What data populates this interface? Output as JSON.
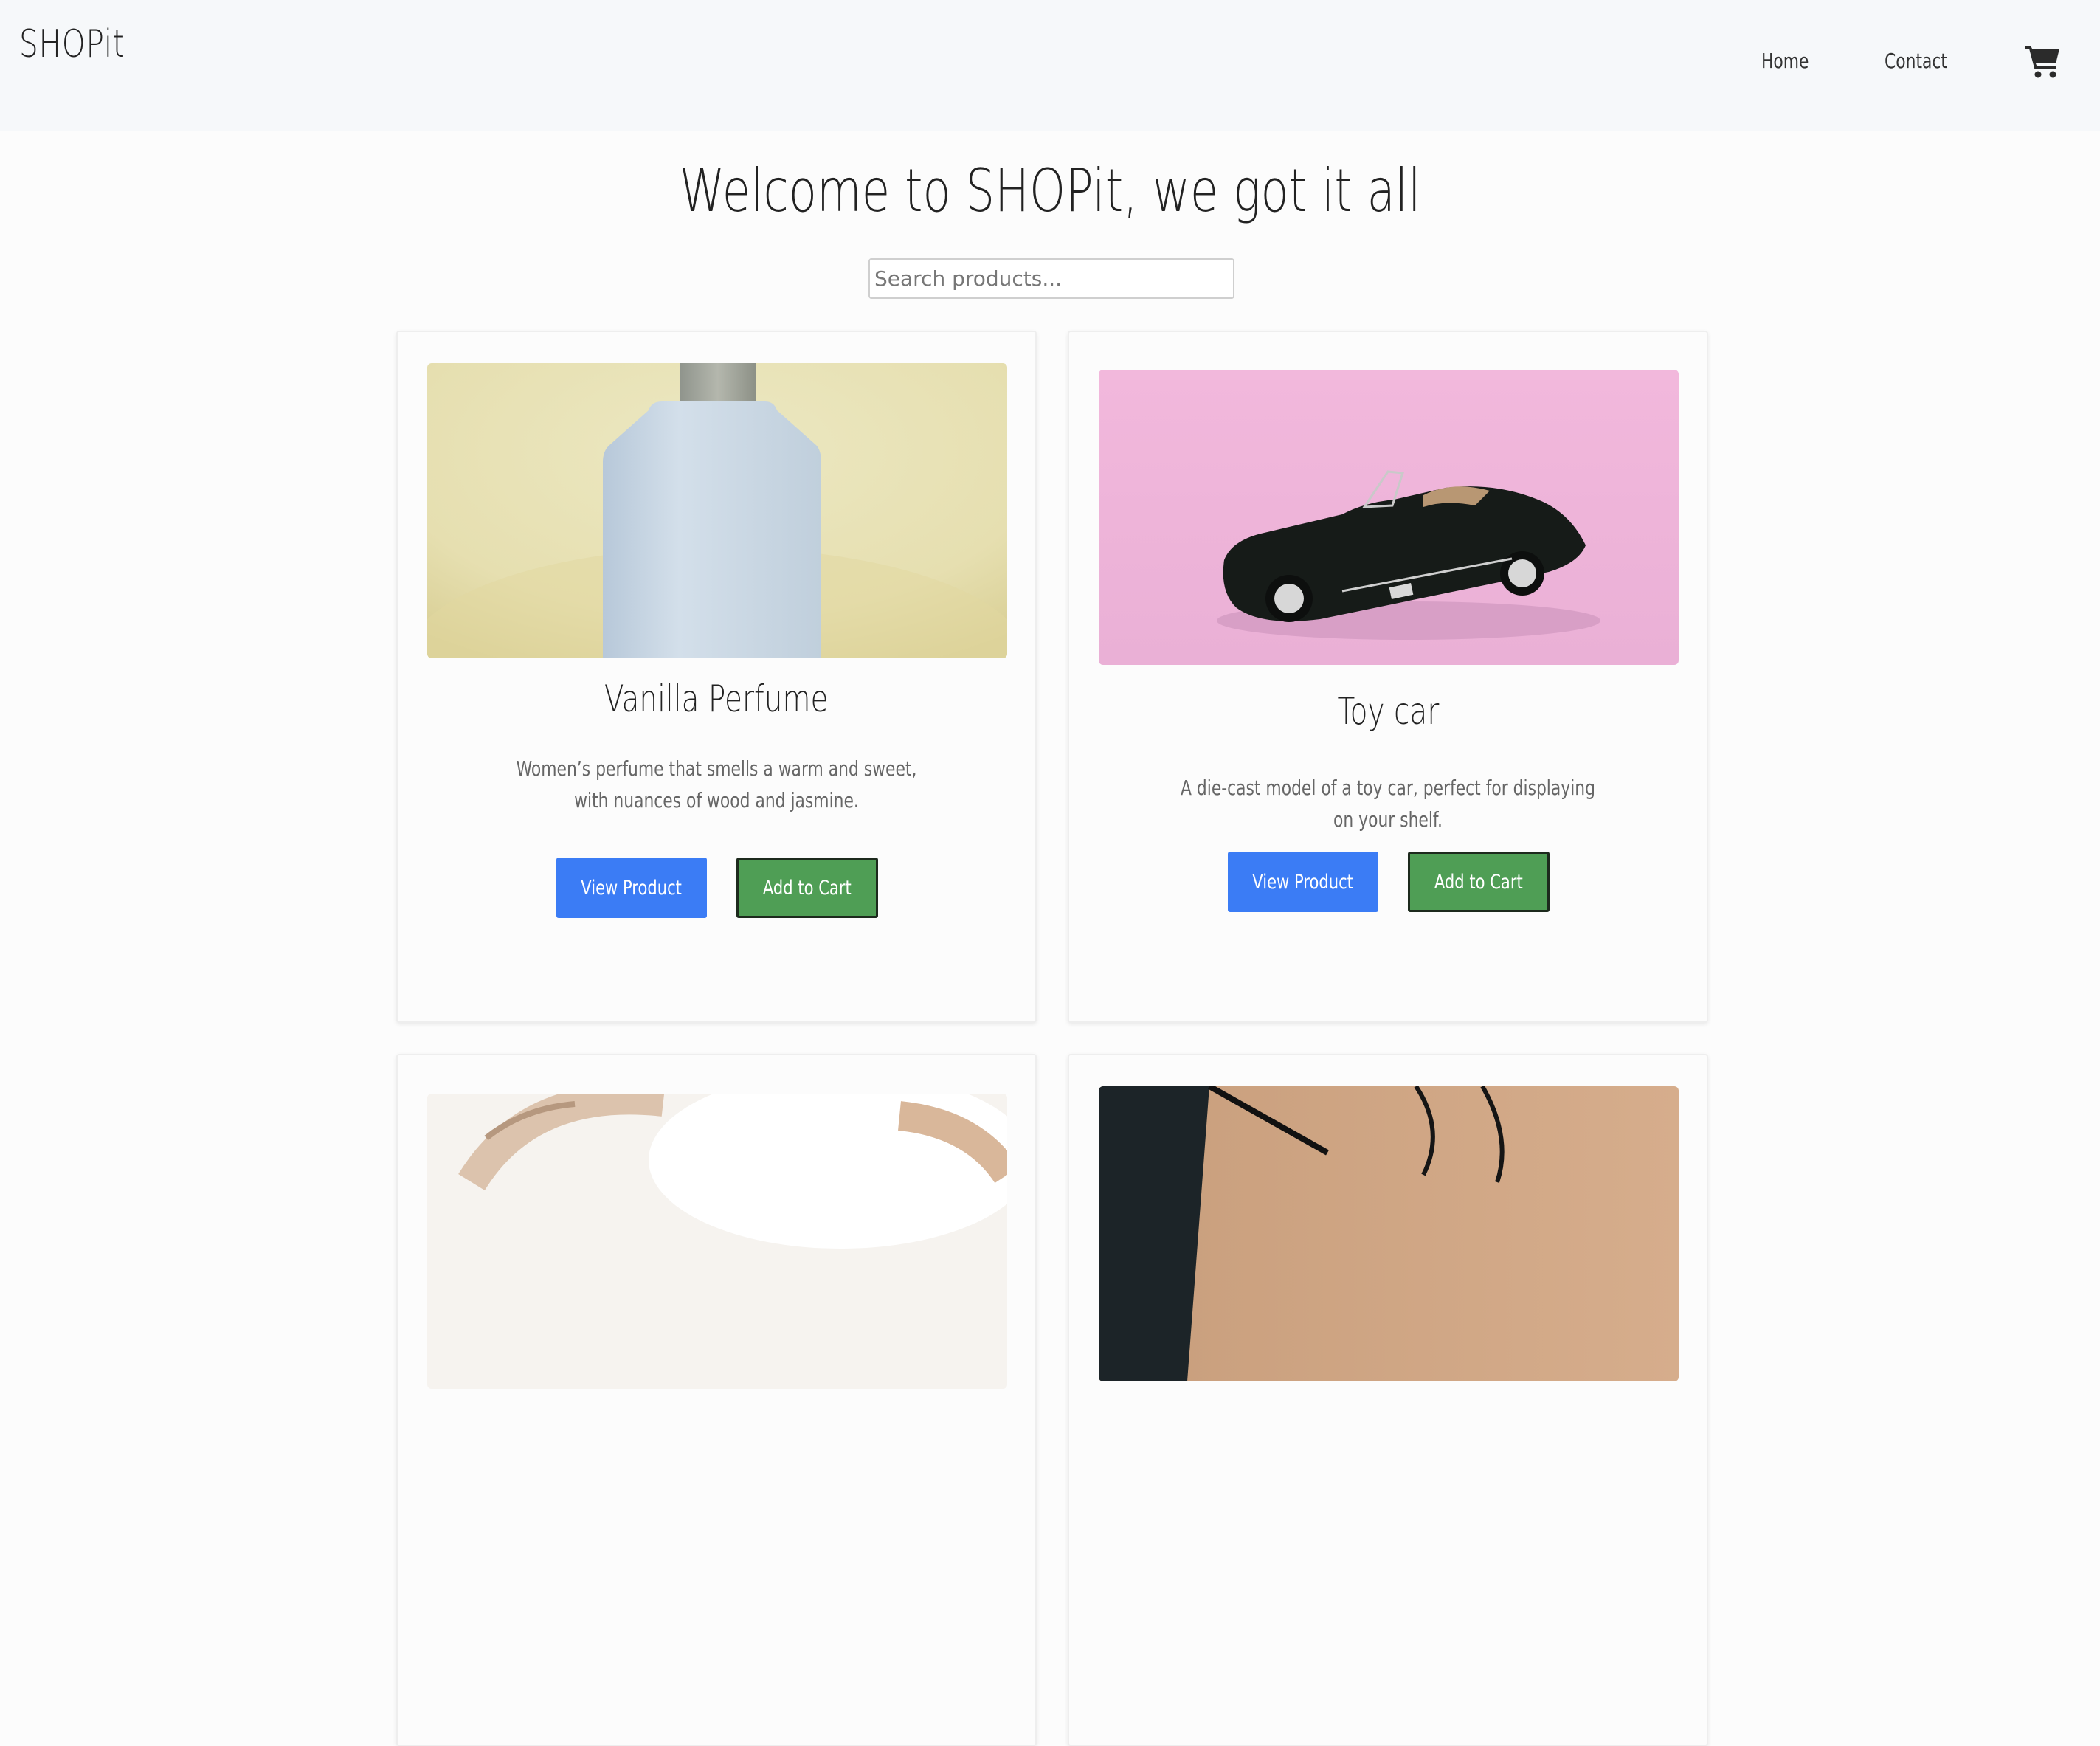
{
  "nav": {
    "brand": "SHOPit",
    "links": [
      "Home",
      "Contact"
    ],
    "cart_icon": "shopping-cart-icon"
  },
  "hero": {
    "title": "Welcome to SHOPit, we got it all"
  },
  "search": {
    "placeholder": "Search products..."
  },
  "products": [
    {
      "name": "Vanilla Perfume",
      "description": "Women’s perfume that smells a warm and sweet, with nuances of wood and jasmine.",
      "image": "perfume-bottle-photo",
      "view_label": "View Product",
      "cart_label": "Add to Cart"
    },
    {
      "name": "Toy car",
      "description": "A die-cast model of a toy car, perfect for displaying on your shelf.",
      "image": "toy-car-photo",
      "view_label": "View Product",
      "cart_label": "Add to Cart"
    },
    {
      "image": "headphones-photo"
    },
    {
      "image": "wooden-desk-photo"
    }
  ],
  "colors": {
    "primary_button": "#3b7cf5",
    "success_button": "#4f9e55",
    "navbar_bg": "#f6f8fa"
  }
}
